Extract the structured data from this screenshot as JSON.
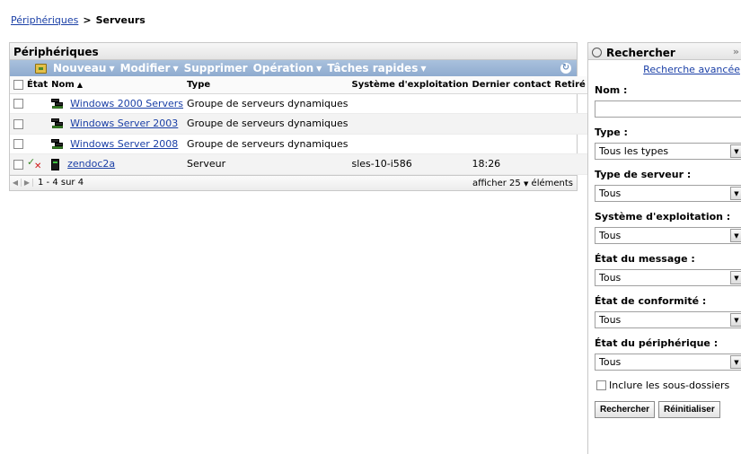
{
  "breadcrumb": {
    "parent": "Périphériques",
    "separator": ">",
    "current": "Serveurs"
  },
  "devices_panel": {
    "title": "Périphériques",
    "toolbar": {
      "new_label": "Nouveau",
      "modify_label": "Modifier",
      "delete_label": "Supprimer",
      "operation_label": "Opération",
      "quick_tasks_label": "Tâches rapides"
    },
    "columns": {
      "status": "État",
      "name": "Nom",
      "type": "Type",
      "os": "Système d'exploitation",
      "last_contact": "Dernier contact",
      "retired": "Retiré"
    },
    "rows": [
      {
        "icon": "server-group-icon",
        "name": "Windows 2000 Servers",
        "type": "Groupe de serveurs dynamiques",
        "os": "",
        "last_contact": "",
        "retired": ""
      },
      {
        "icon": "server-group-icon",
        "name": "Windows Server 2003",
        "type": "Groupe de serveurs dynamiques",
        "os": "",
        "last_contact": "",
        "retired": ""
      },
      {
        "icon": "server-group-icon",
        "name": "Windows Server 2008",
        "type": "Groupe de serveurs dynamiques",
        "os": "",
        "last_contact": "",
        "retired": ""
      },
      {
        "icon": "server-icon",
        "status_icon": "compliance-error-icon",
        "name": "zendoc2a",
        "type": "Serveur",
        "os": "sles-10-i586",
        "last_contact": "18:26",
        "retired": ""
      }
    ],
    "pager": {
      "range": "1 - 4 sur 4",
      "show_label": "afficher",
      "per_page": "25",
      "items_label": "éléments"
    }
  },
  "search_panel": {
    "title": "Rechercher",
    "advanced_link": "Recherche avancée",
    "name_label": "Nom :",
    "name_value": "",
    "type_label": "Type :",
    "type_value": "Tous les types",
    "server_type_label": "Type de serveur :",
    "server_type_value": "Tous",
    "os_label": "Système d'exploitation :",
    "os_value": "Tous",
    "message_state_label": "État du message :",
    "message_state_value": "Tous",
    "compliance_state_label": "État de conformité :",
    "compliance_state_value": "Tous",
    "device_state_label": "État du périphérique :",
    "device_state_value": "Tous",
    "subfolders_label": "Inclure les sous-dossiers",
    "search_button": "Rechercher",
    "reset_button": "Réinitialiser"
  }
}
